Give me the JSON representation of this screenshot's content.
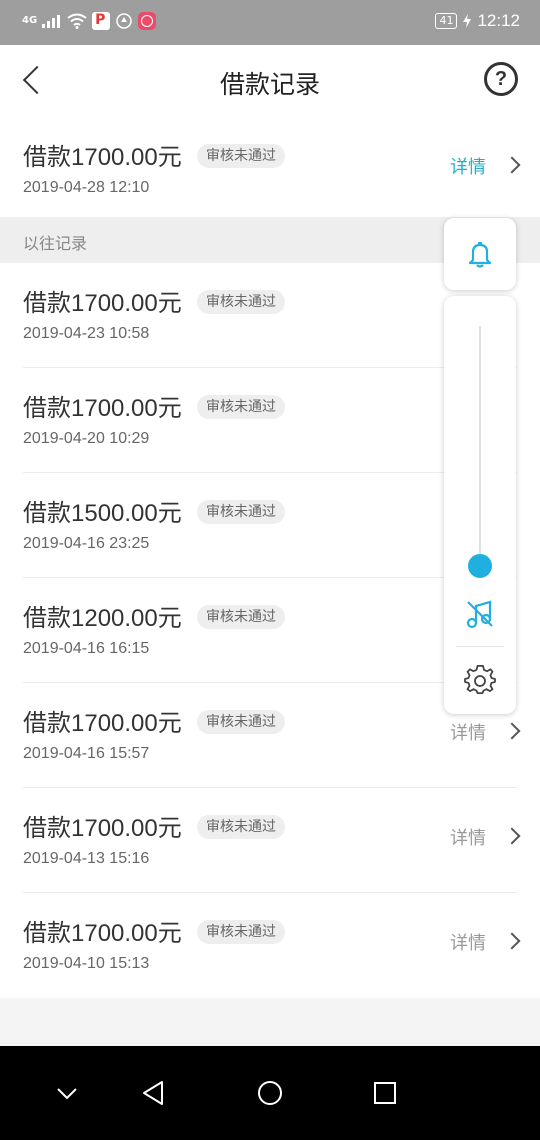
{
  "status_bar": {
    "network": "4G",
    "battery": "41",
    "time": "12:12",
    "icons": [
      "signal-icon",
      "wifi-icon",
      "app-p-icon",
      "shield-icon",
      "app-red-icon",
      "battery-icon",
      "charging-icon"
    ]
  },
  "nav": {
    "title": "借款记录",
    "back_icon": "chevron-left-icon",
    "help_label": "?"
  },
  "current": {
    "amount": "借款1700.00元",
    "status": "审核未通过",
    "date": "2019-04-28 12:10",
    "detail": "详情"
  },
  "section_label": "以往记录",
  "history": [
    {
      "amount": "借款1700.00元",
      "status": "审核未通过",
      "date": "2019-04-23 10:58",
      "detail": ""
    },
    {
      "amount": "借款1700.00元",
      "status": "审核未通过",
      "date": "2019-04-20 10:29",
      "detail": ""
    },
    {
      "amount": "借款1500.00元",
      "status": "审核未通过",
      "date": "2019-04-16 23:25",
      "detail": ""
    },
    {
      "amount": "借款1200.00元",
      "status": "审核未通过",
      "date": "2019-04-16 16:15",
      "detail": ""
    },
    {
      "amount": "借款1700.00元",
      "status": "审核未通过",
      "date": "2019-04-16 15:57",
      "detail": "详情"
    },
    {
      "amount": "借款1700.00元",
      "status": "审核未通过",
      "date": "2019-04-13 15:16",
      "detail": "详情"
    },
    {
      "amount": "借款1700.00元",
      "status": "审核未通过",
      "date": "2019-04-10 15:13",
      "detail": "详情"
    }
  ],
  "volume_panel": {
    "bell_icon": "bell-icon",
    "level": 0.0,
    "mute_icon": "music-off-icon",
    "settings_icon": "gear-icon",
    "accent": "#1fb0e0"
  },
  "system_nav": [
    "chevron-down-icon",
    "back-triangle-icon",
    "home-circle-icon",
    "recents-square-icon"
  ],
  "colors": {
    "accent": "#1fb0c8",
    "badge_bg": "#eeeeee",
    "status_bar": "#9e9e9e"
  }
}
